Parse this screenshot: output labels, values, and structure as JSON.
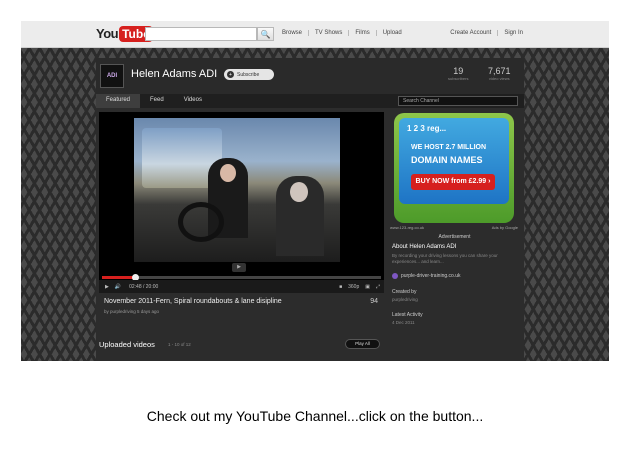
{
  "topbar": {
    "logo_you": "You",
    "logo_tube": "Tube",
    "nav": [
      "Browse",
      "TV Shows",
      "Films",
      "Upload"
    ],
    "account": [
      "Create Account",
      "Sign In"
    ]
  },
  "channel": {
    "avatar_text": "ADI",
    "name": "Helen Adams ADI",
    "subscribe_label": "Subscribe",
    "stats": [
      {
        "value": "19",
        "label": "subscribers"
      },
      {
        "value": "7,671",
        "label": "video views"
      }
    ],
    "tabs": [
      "Featured",
      "Feed",
      "Videos"
    ],
    "search_placeholder": "Search Channel"
  },
  "player": {
    "time": "02:48 / 20:00",
    "quality": "360p",
    "progress": 0.12
  },
  "video": {
    "title": "November 2011-Fern, Spiral roundabouts & lane disipline",
    "by": "by purpledriving 5 days ago",
    "views": "94"
  },
  "uploaded": {
    "title": "Uploaded videos",
    "range": "1 - 10 of 12",
    "play_all": "Play All"
  },
  "ad": {
    "brand": "1 2 3 reg...",
    "line1": "WE HOST 2.7 MILLION",
    "line2": "DOMAIN NAMES",
    "cta": "BUY NOW from £2.99 ›",
    "foot_left": "www.123-reg.co.uk",
    "foot_right": "Ads by Google",
    "label": "Advertisement"
  },
  "about": {
    "title": "About Helen Adams ADI",
    "desc": "By recording your driving lessons you can share your experiences... and learn...",
    "site": "purple-driver-training.co.uk",
    "created_label": "Created by",
    "created_value": "purpledriving",
    "latest_label": "Latest Activity",
    "latest_value": "4 Dec 2011"
  },
  "caption": "Check out my YouTube Channel...click on the button..."
}
